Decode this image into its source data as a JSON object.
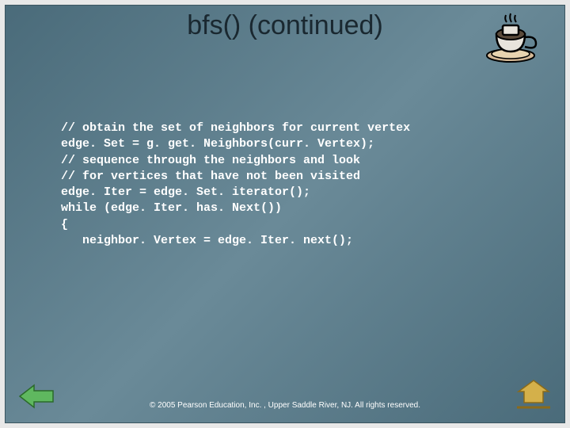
{
  "title": "bfs() (continued)",
  "code": "// obtain the set of neighbors for current vertex\nedge. Set = g. get. Neighbors(curr. Vertex);\n// sequence through the neighbors and look\n// for vertices that have not been visited\nedge. Iter = edge. Set. iterator();\nwhile (edge. Iter. has. Next())\n{\n   neighbor. Vertex = edge. Iter. next();",
  "footer": "© 2005 Pearson Education, Inc. , Upper Saddle River, NJ.  All rights reserved.",
  "icons": {
    "coffee": "coffee-cup-icon",
    "prev": "prev-arrow-icon",
    "next": "home-arrow-icon"
  }
}
